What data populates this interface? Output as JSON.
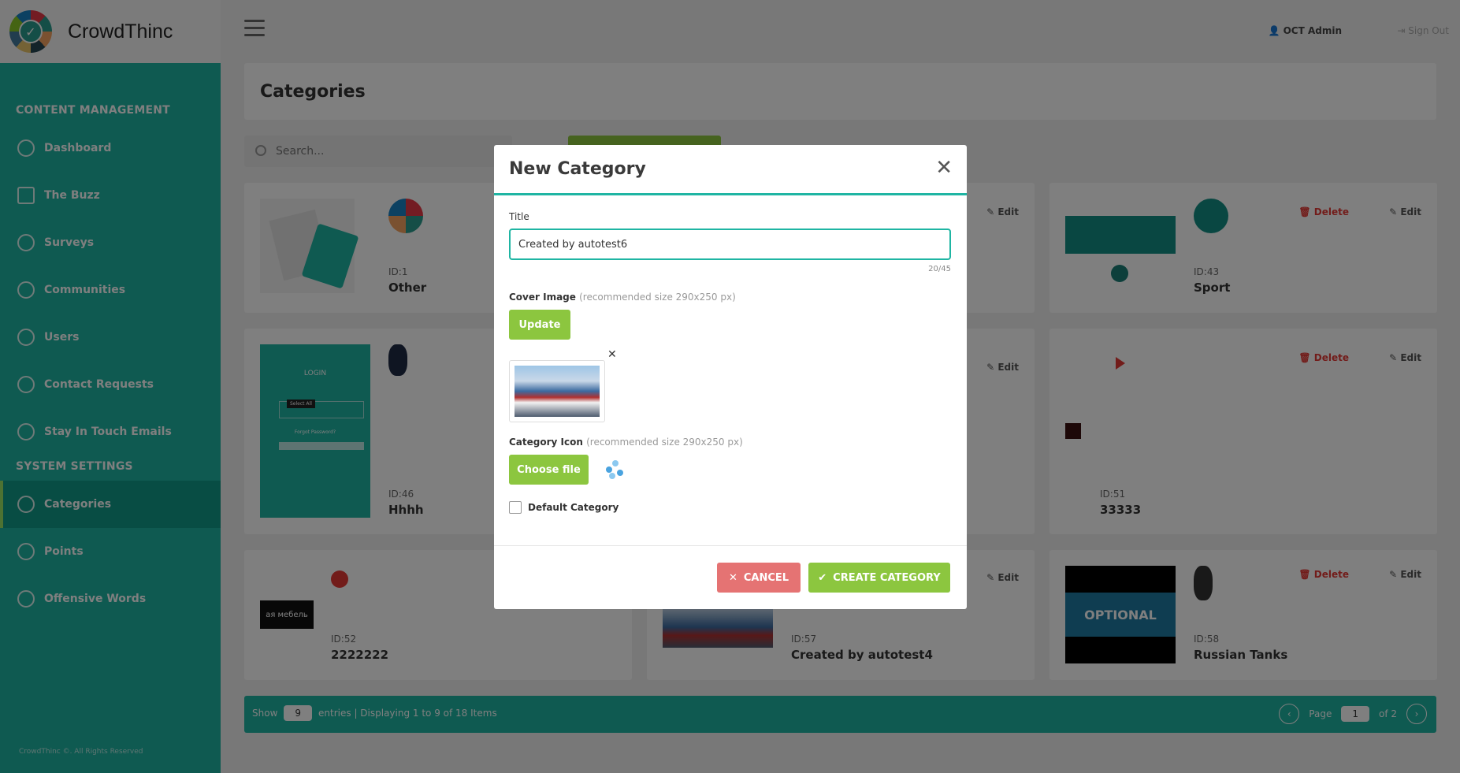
{
  "brand": {
    "name": "CrowdThinc"
  },
  "sidebar": {
    "section_content": "CONTENT MANAGEMENT",
    "items": [
      {
        "label": "Dashboard"
      },
      {
        "label": "The Buzz"
      },
      {
        "label": "Surveys"
      },
      {
        "label": "Communities"
      },
      {
        "label": "Users"
      },
      {
        "label": "Contact Requests"
      },
      {
        "label": "Stay In Touch Emails"
      }
    ],
    "section_system": "SYSTEM SETTINGS",
    "system_items": [
      {
        "label": "Categories"
      },
      {
        "label": "Points"
      },
      {
        "label": "Offensive Words"
      }
    ],
    "copyright": "CrowdThinc ©. All Rights Reserved"
  },
  "header": {
    "user": "OCT Admin",
    "signout": "Sign Out"
  },
  "page": {
    "title": "Categories",
    "search_placeholder": "Search..."
  },
  "cards": [
    {
      "id": "ID:1",
      "name": "Other",
      "edit": "Edit"
    },
    {
      "id": "ID:43",
      "name": "Sport",
      "delete": "Delete",
      "edit": "Edit"
    },
    {
      "id": "ID:46",
      "name": "Hhhh",
      "edit": "Edit"
    },
    {
      "id": "ID:51",
      "name": "33333",
      "delete": "Delete",
      "edit": "Edit"
    },
    {
      "id": "ID:52",
      "name": "2222222"
    },
    {
      "id": "ID:57",
      "name": "Created by autotest4",
      "edit": "Edit"
    },
    {
      "id": "ID:58",
      "name": "Russian Tanks",
      "delete": "Delete",
      "edit": "Edit"
    }
  ],
  "thumb_text": {
    "login": "LOGIN",
    "select_all": "Select All",
    "forgot": "Forgot Password?",
    "mebel": "ая мебель",
    "optional": "OPTIONAL"
  },
  "footer": {
    "show": "Show",
    "entries_value": "9",
    "entries_text": "entries | Displaying 1 to 9 of 18 Items",
    "page": "Page",
    "page_value": "1",
    "of": "of 2"
  },
  "modal": {
    "title": "New Category",
    "title_label": "Title",
    "title_value": "Created by autotest6",
    "counter": "20/45",
    "cover_label": "Cover Image",
    "cover_hint": "(recommended size 290x250 px)",
    "update_btn": "Update",
    "icon_label": "Category Icon",
    "icon_hint": "(recommended size 290x250 px)",
    "choose_btn": "Choose file",
    "default_label": "Default Category",
    "cancel": "CANCEL",
    "create": "CREATE CATEGORY"
  },
  "colors": {
    "teal": "#1fb5a3",
    "green": "#8cc63f",
    "red": "#e57373"
  }
}
